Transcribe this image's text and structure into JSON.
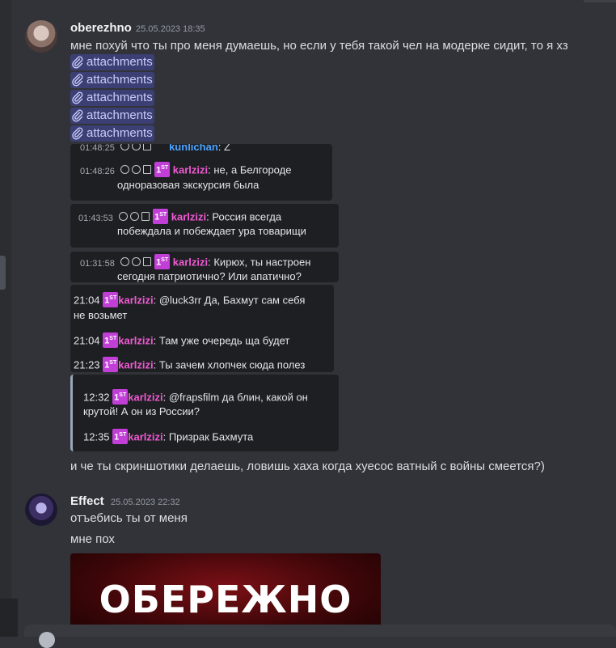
{
  "message1": {
    "username": "oberezhno",
    "timestamp": "25.05.2023 18:35",
    "text": "мне похуй что ты про меня думаешь, но если у тебя такой чел на модерке сидит, то я хз",
    "attachments": [
      "attachments",
      "attachments",
      "attachments",
      "attachments",
      "attachments"
    ]
  },
  "embeds": {
    "panel_a": {
      "row0": {
        "time": "01:48:25",
        "name": "kunlichan",
        "text": ": Z"
      },
      "row1": {
        "time": "01:48:26",
        "name": "karlzizi",
        "text": ": не, а Белгороде",
        "text2": "одноразовая экскурсия была"
      }
    },
    "panel_b": {
      "row1": {
        "time": "01:43:53",
        "name": "karlzizi",
        "text": ": Россия всегда",
        "text2": "побеждала и побеждает ура товарищи"
      }
    },
    "panel_c": {
      "row1": {
        "time": "01:31:58",
        "name": "karlzizi",
        "text": ": Кирюх, ты настроен",
        "text2": "сегодня патриотично? Или апатично?"
      }
    },
    "panel_d": {
      "row1": {
        "time": "21:04",
        "name": "karlzizi",
        "text": ": @luck3rr Да, Бахмут сам себя",
        "text2": "не возьмет"
      },
      "row2": {
        "time": "21:04",
        "name": "karlzizi",
        "text": ": Там уже очередь ща будет"
      },
      "row3": {
        "time": "21:23",
        "name": "karlzizi",
        "text": ": Ты зачем хлопчек сюда полез"
      }
    },
    "panel_e": {
      "row1": {
        "time": "12:32",
        "name": "karlzizi",
        "text": ": @frapsfilm да блин, какой он",
        "text2": "крутой! А он из России?"
      },
      "row2": {
        "time": "12:35",
        "name": "karlzizi",
        "text": ": Призрак Бахмута"
      }
    },
    "badge": "1ST"
  },
  "message1_followup": "и че ты скриншотики делаешь, ловишь хаха когда хуесос ватный с войны смеется?)",
  "message2": {
    "username": "Effect",
    "timestamp": "25.05.2023 22:32",
    "line1": "отъебись ты от меня",
    "line2": "мне пох",
    "image_text": "ОБЕРЕЖНО"
  },
  "icons": {
    "attachment": "paperclip-icon",
    "badge": "first-badge-icon",
    "actions": [
      "block-icon",
      "clock-icon",
      "trash-icon"
    ]
  },
  "colors": {
    "background": "#313338",
    "attachment_bg": "#3c3f74",
    "name_pink": "#ef5ad3",
    "name_blue": "#4aa3ff",
    "badge": "#c13fd6"
  }
}
